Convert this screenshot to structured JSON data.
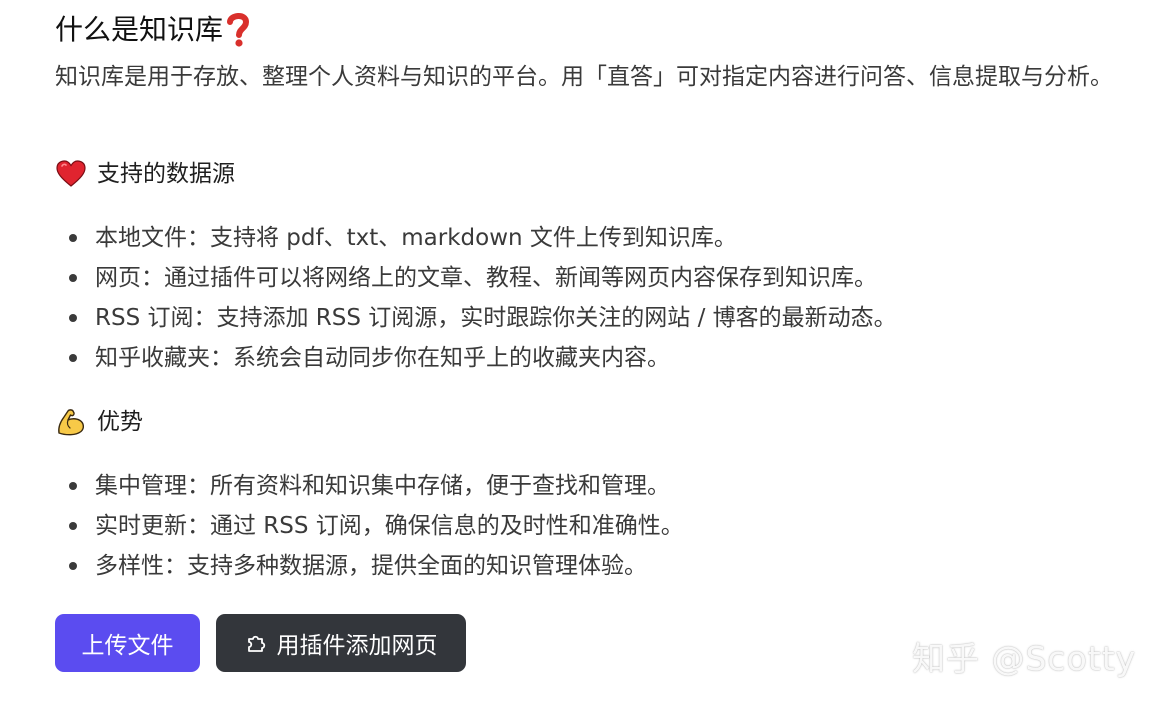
{
  "title": "什么是知识库",
  "intro": "知识库是用于存放、整理个人资料与知识的平台。用「直答」可对指定内容进行问答、信息提取与分析。",
  "sections": {
    "sources": {
      "heading": "支持的数据源",
      "icon": "heart-icon",
      "items": [
        "本地文件：支持将 pdf、txt、markdown 文件上传到知识库。",
        "网页：通过插件可以将网络上的文章、教程、新闻等网页内容保存到知识库。",
        "RSS 订阅：支持添加 RSS 订阅源，实时跟踪你关注的网站 / 博客的最新动态。",
        "知乎收藏夹：系统会自动同步你在知乎上的收藏夹内容。"
      ]
    },
    "advantages": {
      "heading": "优势",
      "icon": "flexed-biceps-icon",
      "items": [
        "集中管理：所有资料和知识集中存储，便于查找和管理。",
        "实时更新：通过 RSS 订阅，确保信息的及时性和准确性。",
        "多样性：支持多种数据源，提供全面的知识管理体验。"
      ]
    }
  },
  "actions": {
    "upload_label": "上传文件",
    "plugin_label": "用插件添加网页",
    "plugin_icon": "puzzle-icon"
  },
  "watermark": "知乎 @Scotty",
  "colors": {
    "primary_button": "#5b4cf0",
    "secondary_button": "#33363b",
    "question_mark": "#d9302c"
  }
}
